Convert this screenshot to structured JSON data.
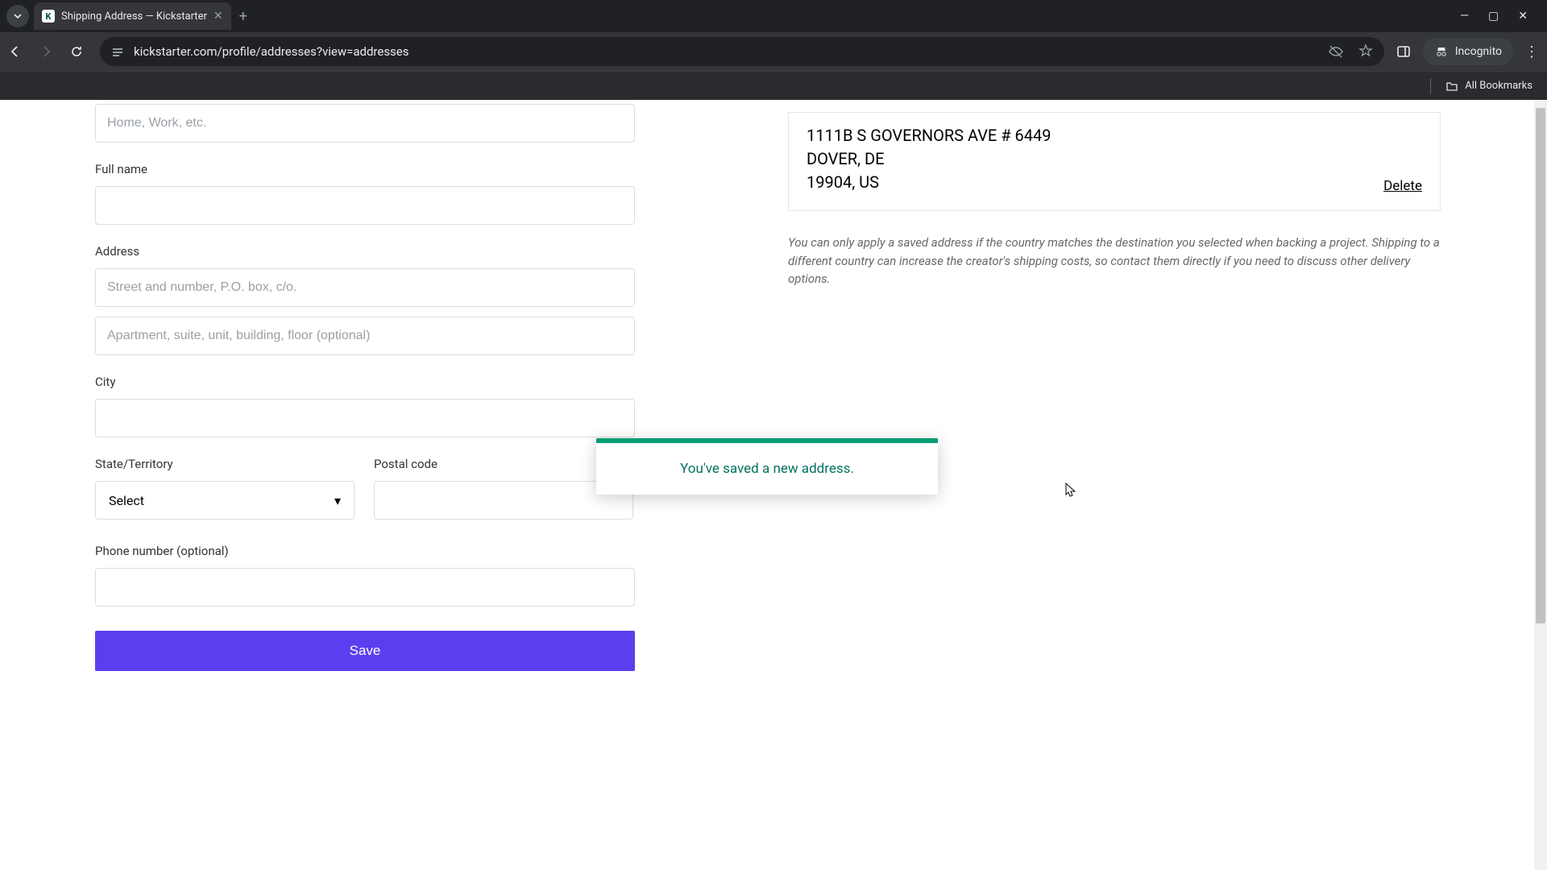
{
  "browser": {
    "tab_title": "Shipping Address — Kickstarter",
    "url": "kickstarter.com/profile/addresses?view=addresses",
    "incognito_label": "Incognito",
    "all_bookmarks": "All Bookmarks"
  },
  "form": {
    "nickname_placeholder": "Home, Work, etc.",
    "fullname_label": "Full name",
    "address_label": "Address",
    "address1_placeholder": "Street and number, P.O. box, c/o.",
    "address2_placeholder": "Apartment, suite, unit, building, floor (optional)",
    "city_label": "City",
    "state_label": "State/Territory",
    "state_selected": "Select",
    "postal_label": "Postal code",
    "phone_label": "Phone number (optional)",
    "save_label": "Save"
  },
  "saved_address": {
    "line1": "1111B S GOVERNORS AVE # 6449",
    "line2": "DOVER, DE",
    "line3": "19904, US",
    "delete_label": "Delete"
  },
  "note_text": "You can only apply a saved address if the country matches the destination you selected when backing a project. Shipping to a different country can increase the creator's shipping costs, so contact them directly if you need to discuss other delivery options.",
  "toast": {
    "message": "You've saved a new address."
  }
}
